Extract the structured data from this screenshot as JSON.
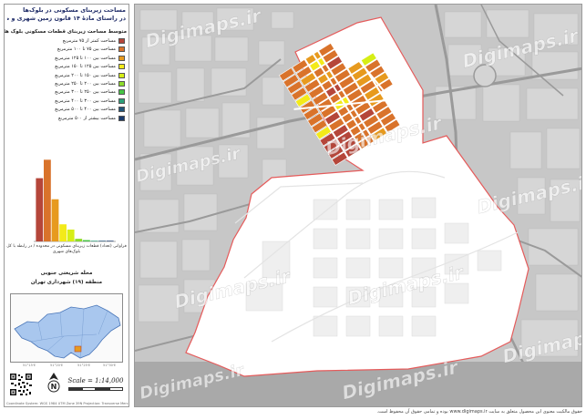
{
  "panel": {
    "title_lines": [
      "مساحت زیربنای مسکونی در بلوک‌ها",
      "در راستای مادهٔ ۱۴ قانون زمین شهری و طرح آماده‌سازی"
    ],
    "legend_title": "متوسط مساحت زیربنای قطعات مسکونی بلوک ها",
    "legend": [
      {
        "label": "مساحت کمتر از ۷۵ مترمربع",
        "color": "#b5463a"
      },
      {
        "label": "مساحت بین ۷۵ تا ۱۰۰ مترمربع",
        "color": "#d9732b"
      },
      {
        "label": "مساحت بین ۱۰۰ تا ۱۲۵ مترمربع",
        "color": "#e79a1e"
      },
      {
        "label": "مساحت بین ۱۲۵ تا ۱۵۰ مترمربع",
        "color": "#f3ea1a"
      },
      {
        "label": "مساحت بین ۱۵۰ تا ۲۰۰ مترمربع",
        "color": "#d6ee16"
      },
      {
        "label": "مساحت بین ۲۰۰ تا ۲۵۰ مترمربع",
        "color": "#8ddc2a"
      },
      {
        "label": "مساحت بین ۲۵۰ تا ۳۰۰ مترمربع",
        "color": "#46c545"
      },
      {
        "label": "مساحت بین ۳۰۰ تا ۴۰۰ مترمربع",
        "color": "#2d9f7a"
      },
      {
        "label": "مساحت بین ۴۰۰ تا ۵۰۰ مترمربع",
        "color": "#22557a"
      },
      {
        "label": "مساحت بیشتر از ۵۰۰ مترمربع",
        "color": "#1a3b6e"
      }
    ],
    "chart_caption": "فراوانی (تعداد) قطعات زیربنای مسکونی در محدوده / در رابطه با کل بلوک‌های شهری",
    "region_lines": [
      "محله شریعتی جنوبی",
      "منطقه (۱۹) شهرداری تهران"
    ],
    "scale": "Scale = 1:14,000",
    "credit": "Coordinate System: WGS 1984 UTM Zone 39N   Projection: Transverse Mercator",
    "north_label": "N",
    "inset_ticks": [
      "51°15'E",
      "51°20'E",
      "51°25'E",
      "51°30'E"
    ]
  },
  "chart_data": {
    "type": "bar",
    "categories": [
      "<75",
      "75-100",
      "100-125",
      "125-150",
      "150-200",
      "200-250",
      "250-300",
      "300-400",
      "400-500",
      ">500"
    ],
    "values": [
      48,
      62,
      32,
      13,
      9,
      2,
      1,
      0.5,
      0.5,
      0.5
    ],
    "colors": [
      "#b5463a",
      "#d9732b",
      "#e79a1e",
      "#f3ea1a",
      "#d6ee16",
      "#8ddc2a",
      "#46c545",
      "#2d9f7a",
      "#22557a",
      "#1a3b6e"
    ],
    "ylim": [
      0,
      65
    ],
    "grid": false,
    "title": "",
    "xlabel": "",
    "ylabel": ""
  },
  "map": {
    "watermark": "Digimaps.ir",
    "colors": {
      "basemap": "#c7c7c7",
      "road": "#9a9a9a",
      "study_area_fill": "#ffffff",
      "study_area_stroke": "#e55b5b"
    }
  },
  "footer": {
    "note": "حقوق مالکیت معنوی این محصول متعلق به سایت www.digimaps.ir بوده و تمامی حقوق آن محفوظ است."
  }
}
